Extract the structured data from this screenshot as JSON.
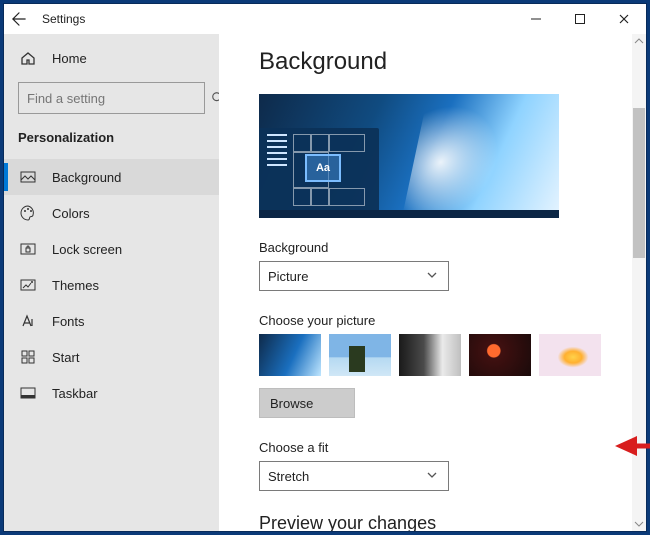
{
  "window": {
    "title": "Settings"
  },
  "sidebar": {
    "home_label": "Home",
    "search_placeholder": "Find a setting",
    "category": "Personalization",
    "items": [
      {
        "label": "Background",
        "selected": true
      },
      {
        "label": "Colors"
      },
      {
        "label": "Lock screen"
      },
      {
        "label": "Themes"
      },
      {
        "label": "Fonts"
      },
      {
        "label": "Start"
      },
      {
        "label": "Taskbar"
      }
    ]
  },
  "main": {
    "title": "Background",
    "preview_sample": "Aa",
    "background_label": "Background",
    "background_value": "Picture",
    "choose_picture_label": "Choose your picture",
    "browse_label": "Browse",
    "choose_fit_label": "Choose a fit",
    "fit_value": "Stretch",
    "preview_changes_label": "Preview your changes"
  }
}
